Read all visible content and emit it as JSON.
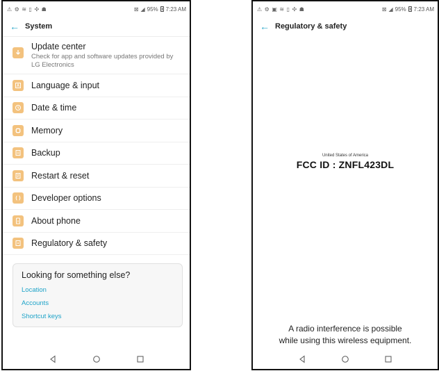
{
  "left_screen": {
    "statusbar": {
      "battery_text": "95%",
      "time": "7:23 AM"
    },
    "appbar": {
      "title": "System"
    },
    "items": [
      {
        "label": "Update center",
        "sub": "Check for app and software updates provided by LG Electronics"
      },
      {
        "label": "Language & input"
      },
      {
        "label": "Date & time"
      },
      {
        "label": "Memory"
      },
      {
        "label": "Backup"
      },
      {
        "label": "Restart & reset"
      },
      {
        "label": "Developer options"
      },
      {
        "label": "About phone"
      },
      {
        "label": "Regulatory & safety"
      }
    ],
    "help": {
      "title": "Looking for something else?",
      "links": [
        "Location",
        "Accounts",
        "Shortcut keys"
      ]
    }
  },
  "right_screen": {
    "statusbar": {
      "battery_text": "95%",
      "time": "7:23 AM"
    },
    "appbar": {
      "title": "Regulatory & safety"
    },
    "country": "United States of America",
    "fcc_id": "FCC ID : ZNFL423DL",
    "note_line1": "A radio interference is possible",
    "note_line2": "while using this wireless equipment."
  },
  "colors": {
    "accent": "#2aa7c9",
    "icon_bg": "#f3c27e",
    "link": "#1ea3c8"
  },
  "icons": {
    "back": "arrow-left-icon",
    "items": [
      "update-icon",
      "language-icon",
      "clock-icon",
      "memory-icon",
      "backup-icon",
      "reset-icon",
      "developer-icon",
      "phone-info-icon",
      "regulatory-icon"
    ],
    "nav": [
      "back-triangle-icon",
      "home-circle-icon",
      "recents-square-icon"
    ]
  }
}
